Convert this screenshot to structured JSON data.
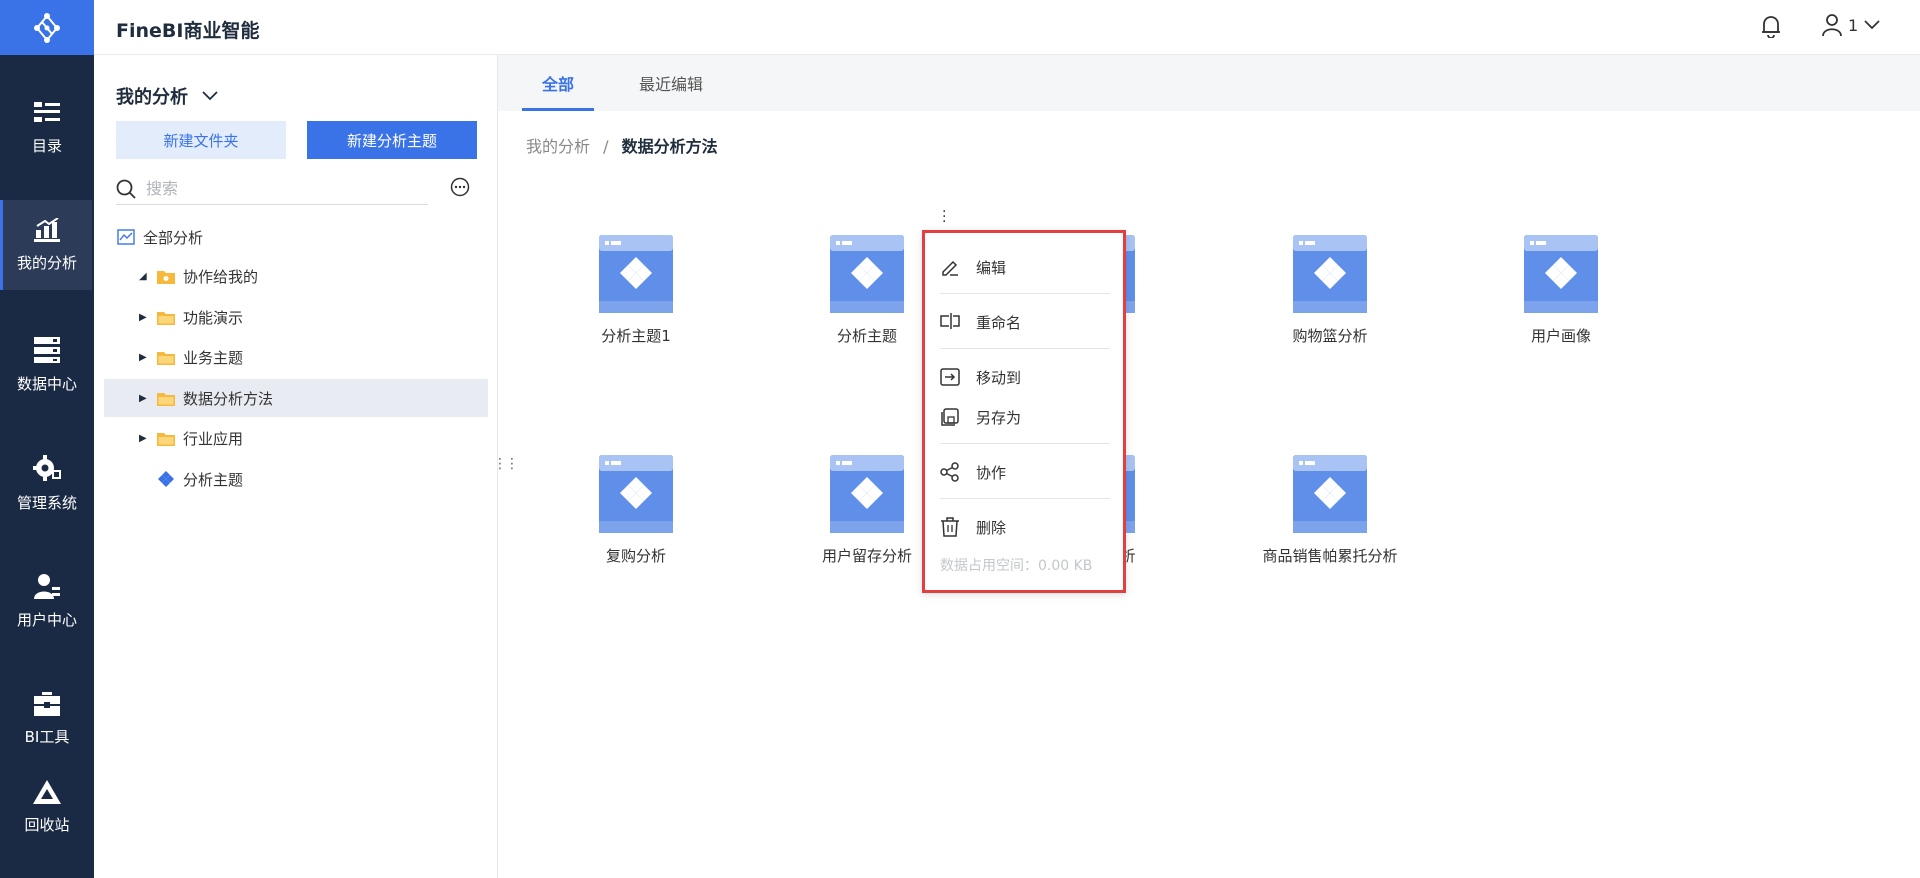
{
  "app": {
    "title": "FineBI商业智能"
  },
  "header": {
    "user_label": "1"
  },
  "rail": {
    "items": [
      {
        "label": "目录",
        "icon": "catalog-icon"
      },
      {
        "label": "我的分析",
        "icon": "chart-icon",
        "active": true
      },
      {
        "label": "数据中心",
        "icon": "database-icon"
      },
      {
        "label": "管理系统",
        "icon": "gear-icon"
      },
      {
        "label": "用户中心",
        "icon": "user-icon"
      },
      {
        "label": "BI工具",
        "icon": "toolbox-icon"
      },
      {
        "label": "回收站",
        "icon": "recycle-icon"
      }
    ]
  },
  "panel": {
    "title": "我的分析",
    "new_folder": "新建文件夹",
    "new_subject": "新建分析主题",
    "search_placeholder": "搜索",
    "tree": [
      {
        "label": "全部分析",
        "type": "all"
      },
      {
        "label": "协作给我的",
        "type": "folder",
        "expanded": true
      },
      {
        "label": "功能演示",
        "type": "folder"
      },
      {
        "label": "业务主题",
        "type": "folder"
      },
      {
        "label": "数据分析方法",
        "type": "folder",
        "selected": true
      },
      {
        "label": "行业应用",
        "type": "folder"
      },
      {
        "label": "分析主题",
        "type": "subject"
      }
    ]
  },
  "main": {
    "tabs": [
      {
        "label": "全部",
        "active": true
      },
      {
        "label": "最近编辑"
      }
    ],
    "breadcrumb": {
      "root": "我的分析",
      "separator": "/",
      "current": "数据分析方法"
    },
    "tiles": [
      {
        "name": "分析主题1"
      },
      {
        "name": "分析主题"
      },
      {
        "name": "析"
      },
      {
        "name": "购物篮分析"
      },
      {
        "name": "用户画像"
      },
      {
        "name": "复购分析"
      },
      {
        "name": "用户留存分析"
      },
      {
        "name": "值分析"
      },
      {
        "name": "商品销售帕累托分析"
      }
    ]
  },
  "context_menu": {
    "items": [
      {
        "label": "编辑",
        "icon": "edit-icon"
      },
      {
        "label": "重命名",
        "icon": "rename-icon"
      },
      {
        "label": "移动到",
        "icon": "move-icon"
      },
      {
        "label": "另存为",
        "icon": "save-as-icon"
      },
      {
        "label": "协作",
        "icon": "share-icon"
      },
      {
        "label": "删除",
        "icon": "trash-icon"
      }
    ],
    "footer": "数据占用空间：0.00 KB"
  },
  "colors": {
    "accent": "#3a73e8",
    "rail_bg": "#1b2a44",
    "highlight_border": "#e53e3e"
  }
}
